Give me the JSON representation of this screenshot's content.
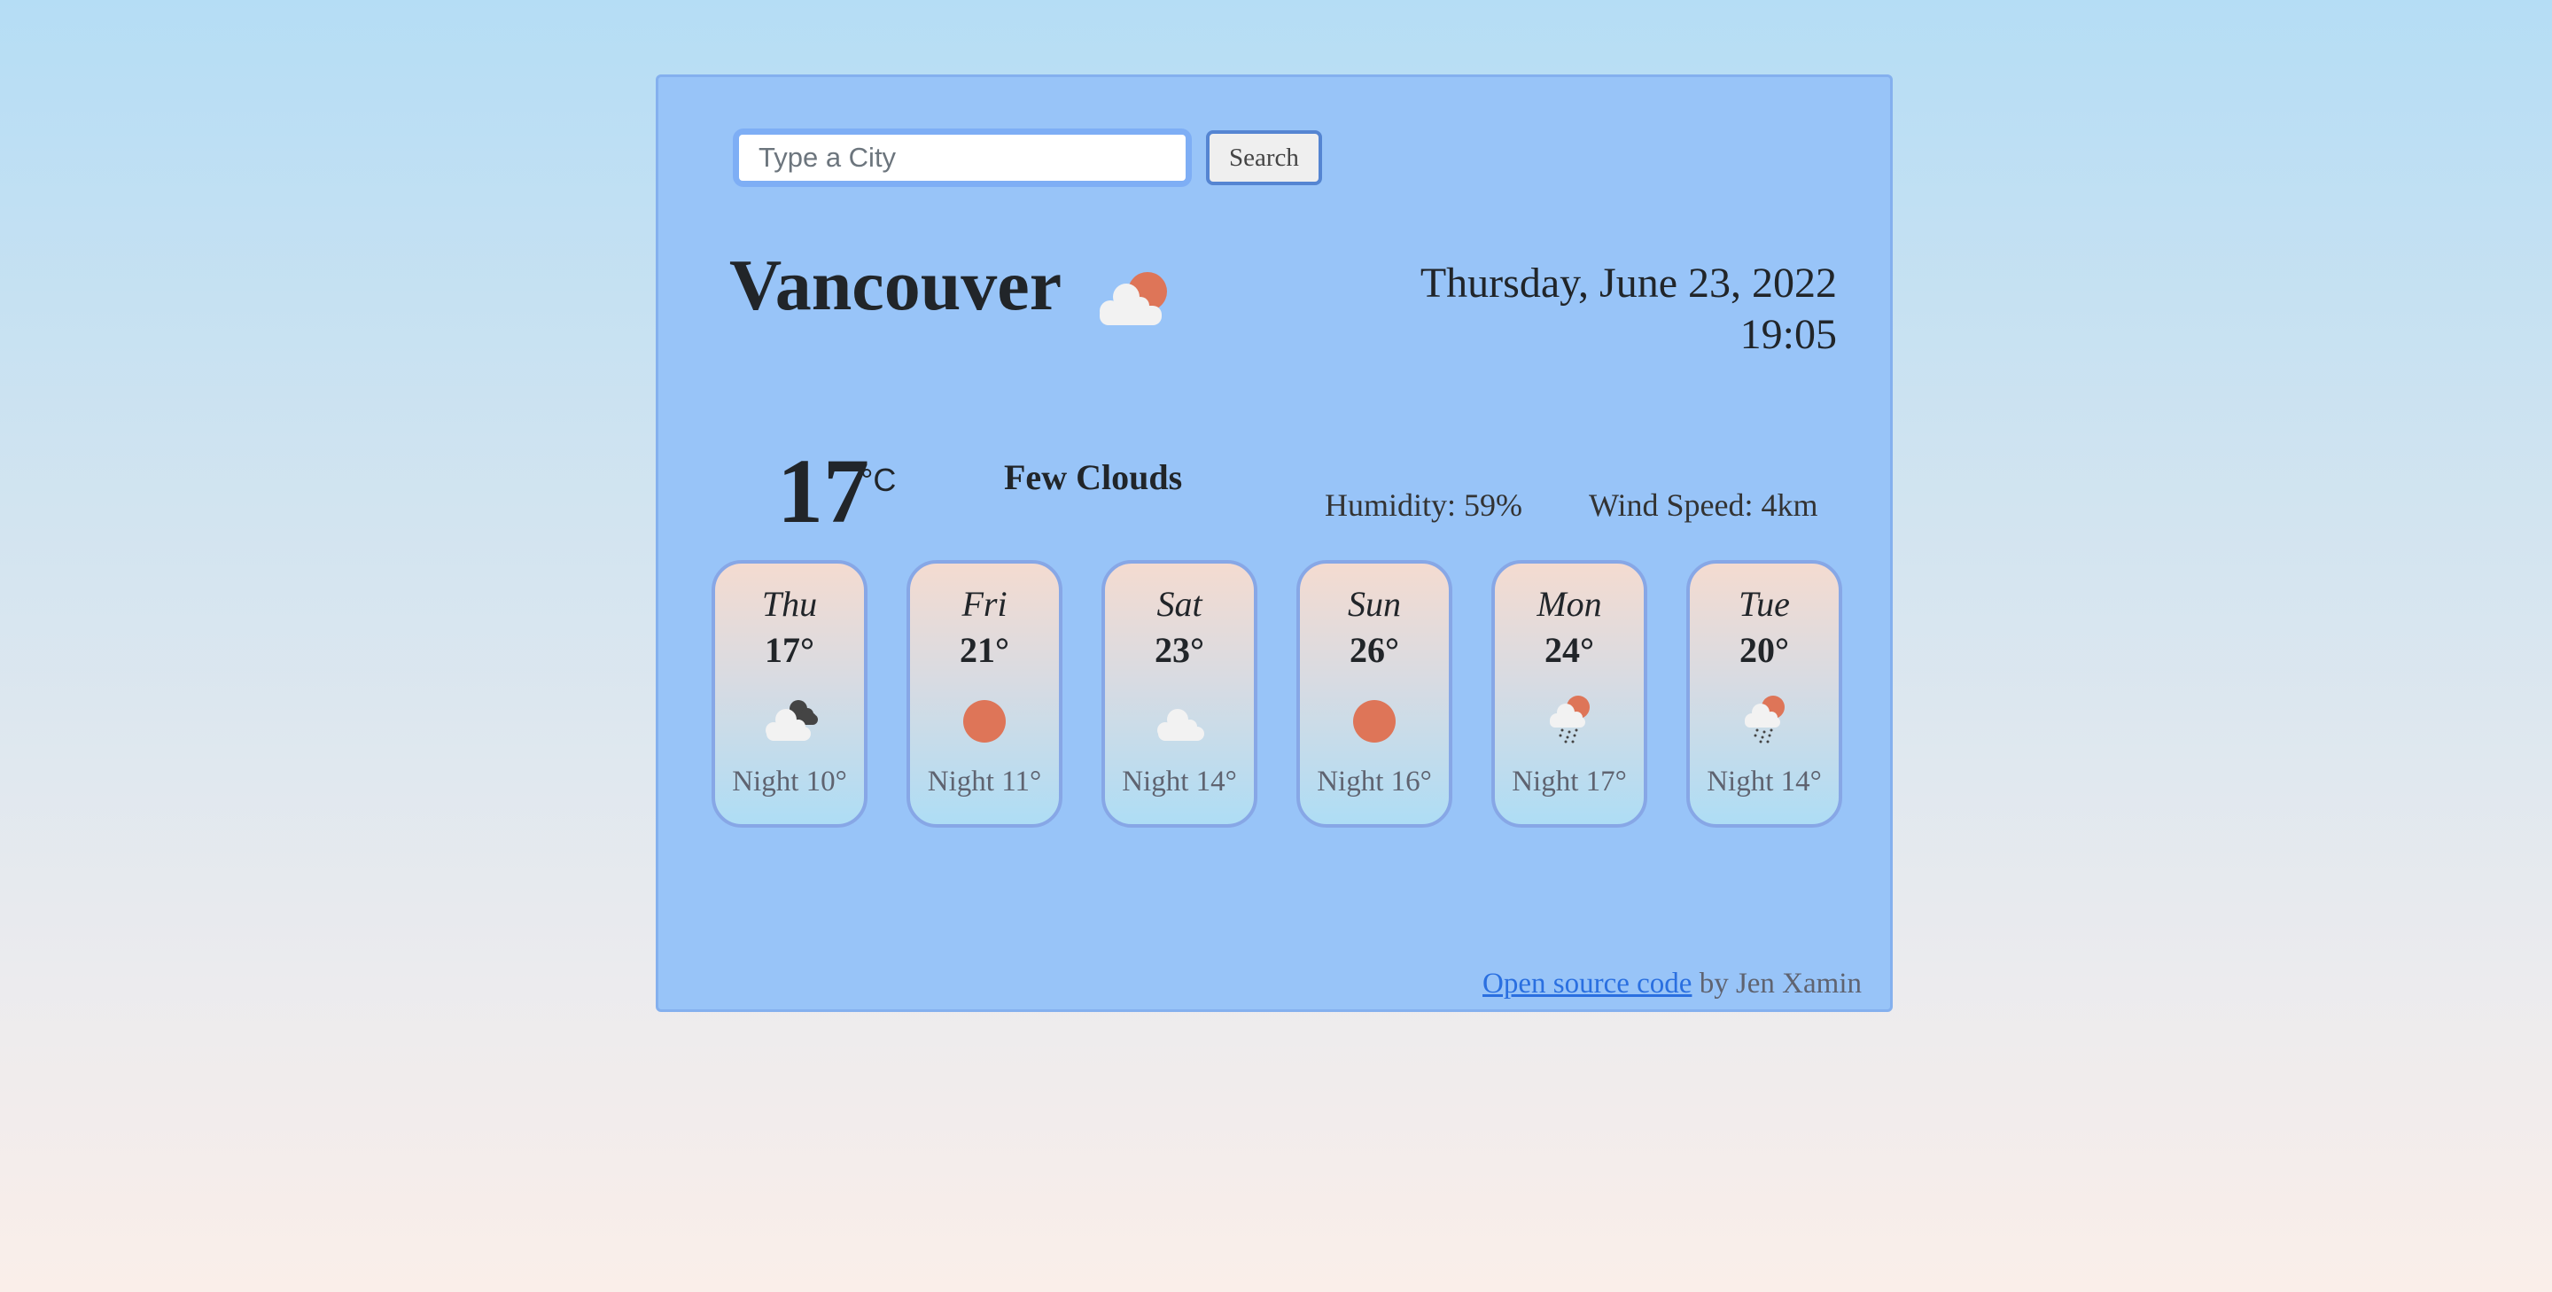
{
  "search": {
    "placeholder": "Type a City",
    "value": "",
    "button_label": "Search"
  },
  "current": {
    "city": "Vancouver",
    "icon": "few-clouds-icon",
    "date": "Thursday, June 23, 2022",
    "time": "19:05",
    "temperature": "17",
    "unit": "°C",
    "description": "Few Clouds",
    "humidity": "Humidity: 59%",
    "wind": "Wind Speed: 4km"
  },
  "forecast": [
    {
      "day": "Thu",
      "high": "17°",
      "icon": "broken-clouds-icon",
      "night": "Night 10°"
    },
    {
      "day": "Fri",
      "high": "21°",
      "icon": "sun-icon",
      "night": "Night 11°"
    },
    {
      "day": "Sat",
      "high": "23°",
      "icon": "cloud-icon",
      "night": "Night 14°"
    },
    {
      "day": "Sun",
      "high": "26°",
      "icon": "sun-icon",
      "night": "Night 16°"
    },
    {
      "day": "Mon",
      "high": "24°",
      "icon": "sun-rain-icon",
      "night": "Night 17°"
    },
    {
      "day": "Tue",
      "high": "20°",
      "icon": "sun-rain-icon",
      "night": "Night 14°"
    }
  ],
  "footer": {
    "link_text": "Open source code",
    "suffix": " by Jen Xamin"
  },
  "colors": {
    "sun": "#de7558",
    "cloud": "#f2f2f2",
    "dark_cloud": "#444444",
    "link": "#2a6fe0"
  }
}
